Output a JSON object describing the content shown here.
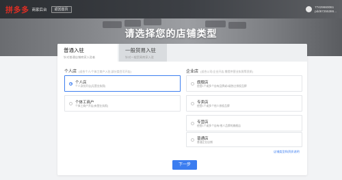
{
  "header": {
    "logo": "拼多多",
    "logo_sub": "商家后台",
    "back_label": "返回首页",
    "user_phone": "77429660061",
    "user_id": "pdd67255386..."
  },
  "hero": {
    "title": "请选择您的店铺类型"
  },
  "tabs": [
    {
      "label": "普通入驻",
      "desc": "针对普通店铺商家入驻者",
      "active": true
    },
    {
      "label": "一般贸易入驻",
      "desc": "针对一般贸易商家入驻",
      "active": false
    }
  ],
  "personal": {
    "label": "个人店",
    "hint": "(适合个人/个体工商户入驻,部分类目可开店)",
    "options": [
      {
        "title": "个人店",
        "desc": "个人身份开店(无营业执照)",
        "selected": true
      },
      {
        "title": "个体工商户",
        "desc": "个体工商户开店(有营业执照)",
        "selected": false
      }
    ]
  },
  "enterprise": {
    "label": "企业店",
    "hint": "(适合公司/企业开店,需提供营业执照等资质)",
    "options": [
      {
        "title": "旗舰店",
        "desc": "经营1个或多个自有品牌或1级独占授权品牌",
        "selected": false
      },
      {
        "title": "专卖店",
        "desc": "经营1个或多个他人授权品牌",
        "selected": false
      },
      {
        "title": "专营店",
        "desc": "经营1个或多个自有/他人品牌的旗舰店",
        "selected": false
      },
      {
        "title": "普通店",
        "desc": "普通企业店铺",
        "selected": false
      }
    ]
  },
  "type_link": "店铺类型和资质说明",
  "next_label": "下一步",
  "colors": {
    "accent": "#3b7df0",
    "brand": "#e02e24"
  }
}
